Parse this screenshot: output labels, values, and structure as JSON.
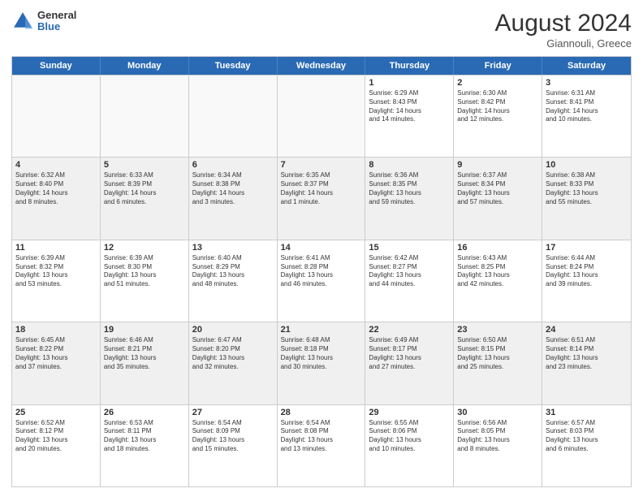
{
  "header": {
    "logo": {
      "general": "General",
      "blue": "Blue"
    },
    "month_year": "August 2024",
    "location": "Giannouli, Greece"
  },
  "days_of_week": [
    "Sunday",
    "Monday",
    "Tuesday",
    "Wednesday",
    "Thursday",
    "Friday",
    "Saturday"
  ],
  "rows": [
    [
      {
        "day": "",
        "info": "",
        "empty": true
      },
      {
        "day": "",
        "info": "",
        "empty": true
      },
      {
        "day": "",
        "info": "",
        "empty": true
      },
      {
        "day": "",
        "info": "",
        "empty": true
      },
      {
        "day": "1",
        "info": "Sunrise: 6:29 AM\nSunset: 8:43 PM\nDaylight: 14 hours\nand 14 minutes."
      },
      {
        "day": "2",
        "info": "Sunrise: 6:30 AM\nSunset: 8:42 PM\nDaylight: 14 hours\nand 12 minutes."
      },
      {
        "day": "3",
        "info": "Sunrise: 6:31 AM\nSunset: 8:41 PM\nDaylight: 14 hours\nand 10 minutes."
      }
    ],
    [
      {
        "day": "4",
        "info": "Sunrise: 6:32 AM\nSunset: 8:40 PM\nDaylight: 14 hours\nand 8 minutes."
      },
      {
        "day": "5",
        "info": "Sunrise: 6:33 AM\nSunset: 8:39 PM\nDaylight: 14 hours\nand 6 minutes."
      },
      {
        "day": "6",
        "info": "Sunrise: 6:34 AM\nSunset: 8:38 PM\nDaylight: 14 hours\nand 3 minutes."
      },
      {
        "day": "7",
        "info": "Sunrise: 6:35 AM\nSunset: 8:37 PM\nDaylight: 14 hours\nand 1 minute."
      },
      {
        "day": "8",
        "info": "Sunrise: 6:36 AM\nSunset: 8:35 PM\nDaylight: 13 hours\nand 59 minutes."
      },
      {
        "day": "9",
        "info": "Sunrise: 6:37 AM\nSunset: 8:34 PM\nDaylight: 13 hours\nand 57 minutes."
      },
      {
        "day": "10",
        "info": "Sunrise: 6:38 AM\nSunset: 8:33 PM\nDaylight: 13 hours\nand 55 minutes."
      }
    ],
    [
      {
        "day": "11",
        "info": "Sunrise: 6:39 AM\nSunset: 8:32 PM\nDaylight: 13 hours\nand 53 minutes."
      },
      {
        "day": "12",
        "info": "Sunrise: 6:39 AM\nSunset: 8:30 PM\nDaylight: 13 hours\nand 51 minutes."
      },
      {
        "day": "13",
        "info": "Sunrise: 6:40 AM\nSunset: 8:29 PM\nDaylight: 13 hours\nand 48 minutes."
      },
      {
        "day": "14",
        "info": "Sunrise: 6:41 AM\nSunset: 8:28 PM\nDaylight: 13 hours\nand 46 minutes."
      },
      {
        "day": "15",
        "info": "Sunrise: 6:42 AM\nSunset: 8:27 PM\nDaylight: 13 hours\nand 44 minutes."
      },
      {
        "day": "16",
        "info": "Sunrise: 6:43 AM\nSunset: 8:25 PM\nDaylight: 13 hours\nand 42 minutes."
      },
      {
        "day": "17",
        "info": "Sunrise: 6:44 AM\nSunset: 8:24 PM\nDaylight: 13 hours\nand 39 minutes."
      }
    ],
    [
      {
        "day": "18",
        "info": "Sunrise: 6:45 AM\nSunset: 8:22 PM\nDaylight: 13 hours\nand 37 minutes."
      },
      {
        "day": "19",
        "info": "Sunrise: 6:46 AM\nSunset: 8:21 PM\nDaylight: 13 hours\nand 35 minutes."
      },
      {
        "day": "20",
        "info": "Sunrise: 6:47 AM\nSunset: 8:20 PM\nDaylight: 13 hours\nand 32 minutes."
      },
      {
        "day": "21",
        "info": "Sunrise: 6:48 AM\nSunset: 8:18 PM\nDaylight: 13 hours\nand 30 minutes."
      },
      {
        "day": "22",
        "info": "Sunrise: 6:49 AM\nSunset: 8:17 PM\nDaylight: 13 hours\nand 27 minutes."
      },
      {
        "day": "23",
        "info": "Sunrise: 6:50 AM\nSunset: 8:15 PM\nDaylight: 13 hours\nand 25 minutes."
      },
      {
        "day": "24",
        "info": "Sunrise: 6:51 AM\nSunset: 8:14 PM\nDaylight: 13 hours\nand 23 minutes."
      }
    ],
    [
      {
        "day": "25",
        "info": "Sunrise: 6:52 AM\nSunset: 8:12 PM\nDaylight: 13 hours\nand 20 minutes."
      },
      {
        "day": "26",
        "info": "Sunrise: 6:53 AM\nSunset: 8:11 PM\nDaylight: 13 hours\nand 18 minutes."
      },
      {
        "day": "27",
        "info": "Sunrise: 6:54 AM\nSunset: 8:09 PM\nDaylight: 13 hours\nand 15 minutes."
      },
      {
        "day": "28",
        "info": "Sunrise: 6:54 AM\nSunset: 8:08 PM\nDaylight: 13 hours\nand 13 minutes."
      },
      {
        "day": "29",
        "info": "Sunrise: 6:55 AM\nSunset: 8:06 PM\nDaylight: 13 hours\nand 10 minutes."
      },
      {
        "day": "30",
        "info": "Sunrise: 6:56 AM\nSunset: 8:05 PM\nDaylight: 13 hours\nand 8 minutes."
      },
      {
        "day": "31",
        "info": "Sunrise: 6:57 AM\nSunset: 8:03 PM\nDaylight: 13 hours\nand 6 minutes."
      }
    ]
  ],
  "colors": {
    "header_bg": "#2a6ab5",
    "header_text": "#ffffff",
    "border": "#cccccc",
    "shaded": "#f0f0f0",
    "empty": "#f9f9f9"
  }
}
